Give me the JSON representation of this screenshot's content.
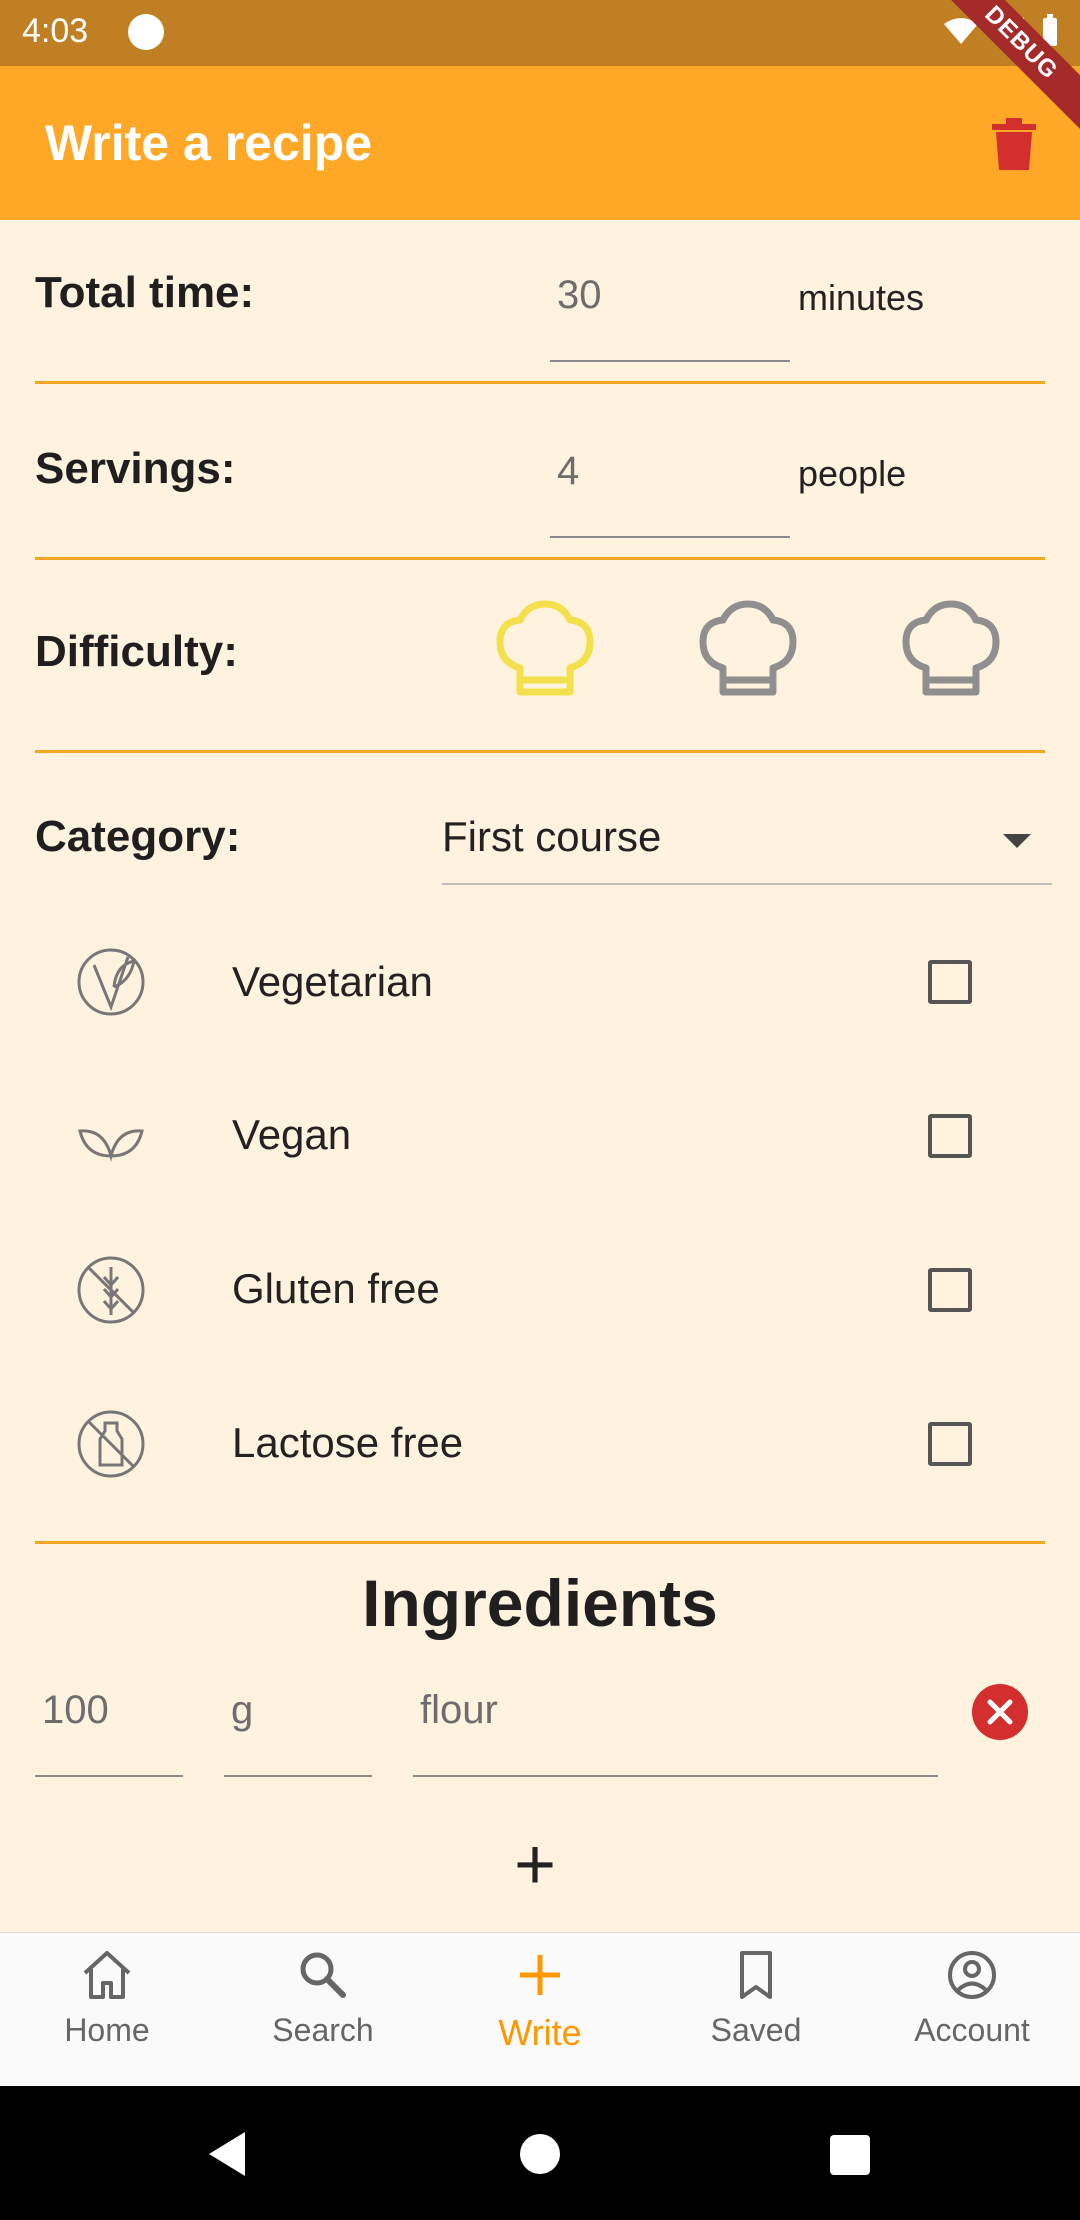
{
  "status": {
    "time": "4:03",
    "debug": "DEBUG"
  },
  "appbar": {
    "title": "Write a recipe"
  },
  "total_time": {
    "label": "Total time:",
    "value": "30",
    "unit": "minutes"
  },
  "servings": {
    "label": "Servings:",
    "value": "4",
    "unit": "people"
  },
  "difficulty": {
    "label": "Difficulty:",
    "level": 1,
    "max": 3,
    "active_color": "#f4e04d",
    "inactive_color": "#8f8f8f"
  },
  "category": {
    "label": "Category:",
    "value": "First course"
  },
  "diet": [
    {
      "label": "Vegetarian",
      "icon": "leaf-circle-icon",
      "checked": false
    },
    {
      "label": "Vegan",
      "icon": "leaves-icon",
      "checked": false
    },
    {
      "label": "Gluten free",
      "icon": "no-wheat-icon",
      "checked": false
    },
    {
      "label": "Lactose free",
      "icon": "no-milk-icon",
      "checked": false
    }
  ],
  "ingredients": {
    "title": "Ingredients",
    "items": [
      {
        "quantity": "100",
        "unit": "g",
        "name": "flour"
      }
    ],
    "add_label": "+"
  },
  "nav": [
    {
      "label": "Home",
      "icon": "home-icon"
    },
    {
      "label": "Search",
      "icon": "search-icon"
    },
    {
      "label": "Write",
      "icon": "plus-icon",
      "active": true
    },
    {
      "label": "Saved",
      "icon": "bookmark-icon"
    },
    {
      "label": "Account",
      "icon": "account-icon"
    }
  ],
  "colors": {
    "accent": "#ffa726",
    "divider": "#f5a623",
    "background": "#fff3e0",
    "remove": "#d32f2f"
  }
}
